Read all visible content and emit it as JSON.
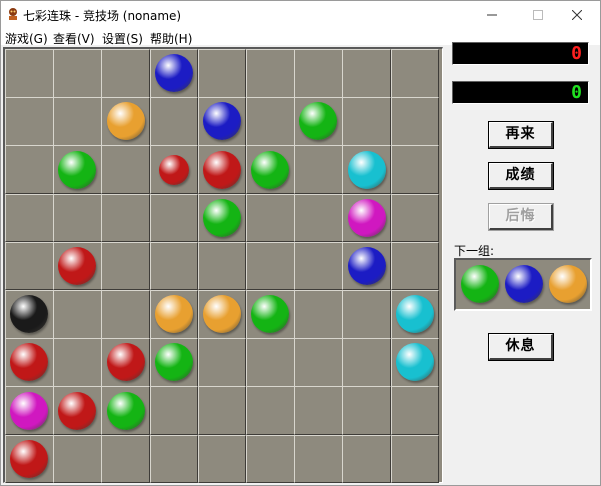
{
  "window": {
    "title": "七彩连珠 - 竞技场  (noname)",
    "minimize_icon": "minimize-icon",
    "maximize_icon": "maximize-icon",
    "close_icon": "close-icon"
  },
  "menu": [
    {
      "label": "游戏(G)",
      "name": "menu-game"
    },
    {
      "label": "查看(V)",
      "name": "menu-view"
    },
    {
      "label": "设置(S)",
      "name": "menu-settings"
    },
    {
      "label": "帮助(H)",
      "name": "menu-help"
    }
  ],
  "colors": {
    "blue": "#1c1cc4",
    "green": "#14b414",
    "orange": "#e8a030",
    "red": "#c01818",
    "cyan": "#18c0d0",
    "magenta": "#d018c0",
    "black": "#1a1a1a",
    "score_red": "#ff2020",
    "score_green": "#20e020"
  },
  "board": {
    "rows": 9,
    "cols": 9,
    "balls": [
      {
        "row": 0,
        "col": 3,
        "color": "blue"
      },
      {
        "row": 1,
        "col": 2,
        "color": "orange"
      },
      {
        "row": 1,
        "col": 4,
        "color": "blue"
      },
      {
        "row": 1,
        "col": 6,
        "color": "green"
      },
      {
        "row": 2,
        "col": 1,
        "color": "green"
      },
      {
        "row": 2,
        "col": 3,
        "color": "red",
        "small": true
      },
      {
        "row": 2,
        "col": 4,
        "color": "red"
      },
      {
        "row": 2,
        "col": 5,
        "color": "green"
      },
      {
        "row": 2,
        "col": 7,
        "color": "cyan"
      },
      {
        "row": 3,
        "col": 4,
        "color": "green"
      },
      {
        "row": 3,
        "col": 7,
        "color": "magenta"
      },
      {
        "row": 4,
        "col": 1,
        "color": "red"
      },
      {
        "row": 4,
        "col": 7,
        "color": "blue"
      },
      {
        "row": 5,
        "col": 0,
        "color": "black"
      },
      {
        "row": 5,
        "col": 3,
        "color": "orange"
      },
      {
        "row": 5,
        "col": 4,
        "color": "orange"
      },
      {
        "row": 5,
        "col": 5,
        "color": "green"
      },
      {
        "row": 5,
        "col": 8,
        "color": "cyan"
      },
      {
        "row": 6,
        "col": 0,
        "color": "red"
      },
      {
        "row": 6,
        "col": 2,
        "color": "red"
      },
      {
        "row": 6,
        "col": 3,
        "color": "green"
      },
      {
        "row": 6,
        "col": 8,
        "color": "cyan"
      },
      {
        "row": 7,
        "col": 0,
        "color": "magenta"
      },
      {
        "row": 7,
        "col": 1,
        "color": "red"
      },
      {
        "row": 7,
        "col": 2,
        "color": "green"
      },
      {
        "row": 8,
        "col": 0,
        "color": "red"
      }
    ]
  },
  "scores": {
    "high": "0",
    "current": "0"
  },
  "buttons": {
    "restart": "再来",
    "scores": "成绩",
    "undo": "后悔",
    "pause": "休息"
  },
  "next": {
    "label": "下一组:",
    "balls": [
      "green",
      "blue",
      "orange"
    ]
  }
}
